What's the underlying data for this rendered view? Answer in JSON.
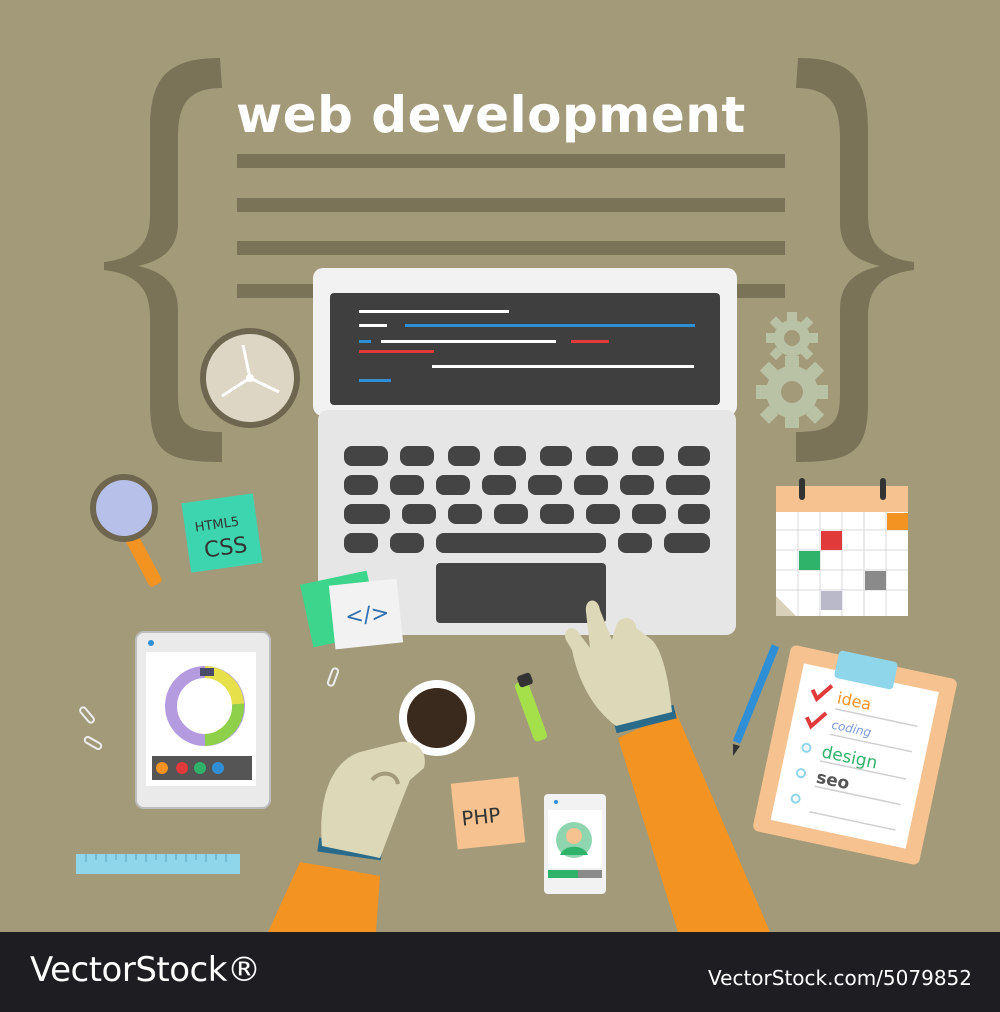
{
  "headline": "web development",
  "stickers": {
    "html5": "HTML5",
    "css": "CSS",
    "code_tag": "</>",
    "php": "PHP"
  },
  "checklist": {
    "items": [
      "idea",
      "coding",
      "design",
      "seo"
    ]
  },
  "footer": {
    "brand": "VectorStock®",
    "image_id": "VectorStock.com/5079852"
  },
  "colors": {
    "background": "#a39a7a",
    "brace": "#7a7358",
    "sleeve": "#f39322",
    "skin": "#ddd8b8",
    "accent_red": "#e03a3a",
    "accent_blue": "#2f8fd6",
    "footer_bg": "#1e1e22"
  }
}
